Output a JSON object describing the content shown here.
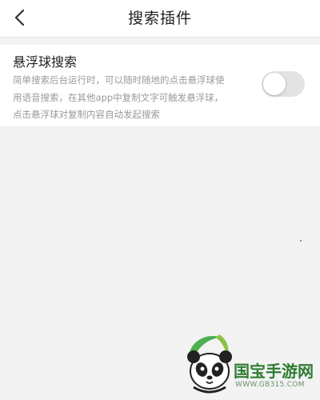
{
  "header": {
    "back_icon": "chevron-left-icon",
    "title": "搜索插件"
  },
  "setting": {
    "title": "悬浮球搜索",
    "description_lines": [
      "简单搜索后台运行时，可以随时随地的点击悬浮球使",
      "用语音搜索，在其他app中复制文字可触发悬浮球，",
      "点击悬浮球对复制内容自动发起搜索"
    ],
    "toggle_on": false
  },
  "watermark": {
    "brand": "国宝手游网",
    "url": "WWW.GB315.COM"
  },
  "colors": {
    "toggle_off": "#e3e3e3",
    "brand_green": "#2e7d32",
    "background": "#f3f3f3"
  }
}
